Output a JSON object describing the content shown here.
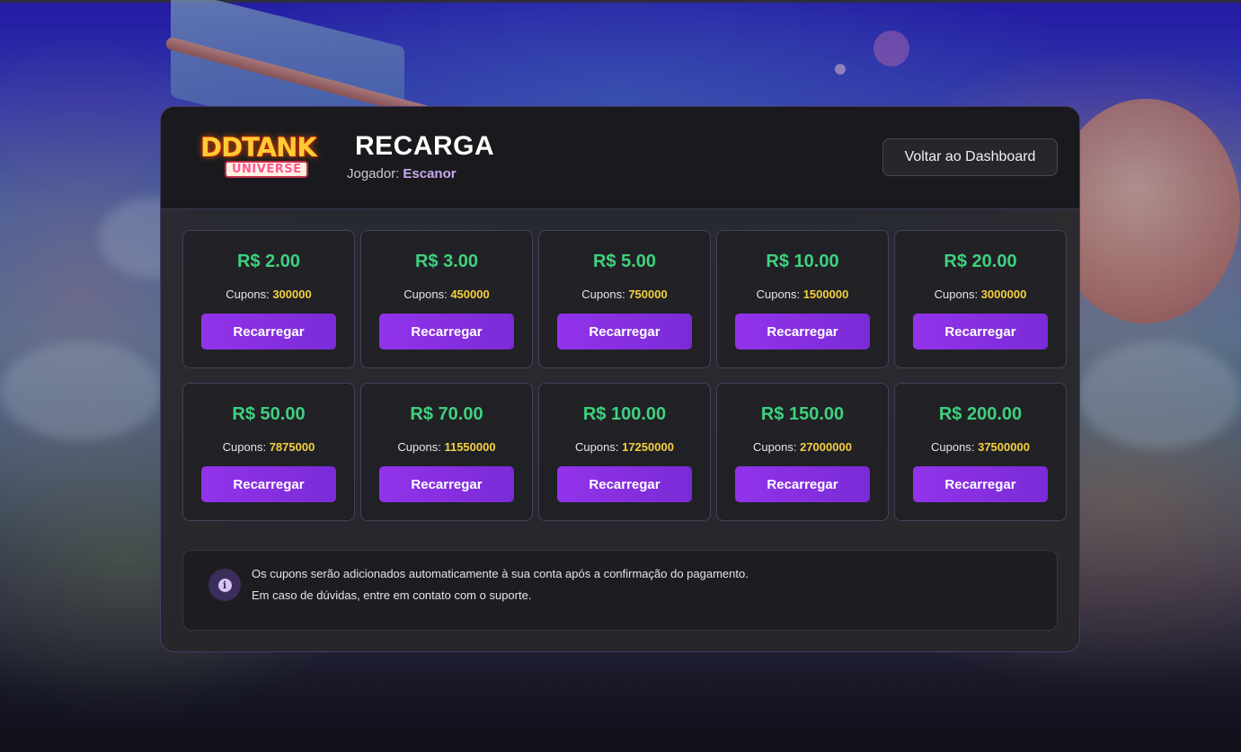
{
  "header": {
    "logo_text": "DDTANK",
    "logo_subtext": "UNIVERSE",
    "title": "RECARGA",
    "player_label": "Jogador:",
    "player_name": "Escanor",
    "back_button": "Voltar ao Dashboard"
  },
  "packages": [
    {
      "price": "R$ 2.00",
      "coupons_label": "Cupons:",
      "coupons": "300000",
      "button": "Recarregar"
    },
    {
      "price": "R$ 3.00",
      "coupons_label": "Cupons:",
      "coupons": "450000",
      "button": "Recarregar"
    },
    {
      "price": "R$ 5.00",
      "coupons_label": "Cupons:",
      "coupons": "750000",
      "button": "Recarregar"
    },
    {
      "price": "R$ 10.00",
      "coupons_label": "Cupons:",
      "coupons": "1500000",
      "button": "Recarregar"
    },
    {
      "price": "R$ 20.00",
      "coupons_label": "Cupons:",
      "coupons": "3000000",
      "button": "Recarregar"
    },
    {
      "price": "R$ 50.00",
      "coupons_label": "Cupons:",
      "coupons": "7875000",
      "button": "Recarregar"
    },
    {
      "price": "R$ 70.00",
      "coupons_label": "Cupons:",
      "coupons": "11550000",
      "button": "Recarregar"
    },
    {
      "price": "R$ 100.00",
      "coupons_label": "Cupons:",
      "coupons": "17250000",
      "button": "Recarregar"
    },
    {
      "price": "R$ 150.00",
      "coupons_label": "Cupons:",
      "coupons": "27000000",
      "button": "Recarregar"
    },
    {
      "price": "R$ 200.00",
      "coupons_label": "Cupons:",
      "coupons": "37500000",
      "button": "Recarregar"
    }
  ],
  "info": {
    "icon": "info-icon",
    "icon_glyph": "i",
    "line1": "Os cupons serão adicionados automaticamente à sua conta após a confirmação do pagamento.",
    "line2": "Em caso de dúvidas, entre em contato com o suporte."
  },
  "colors": {
    "price": "#3fd17e",
    "coupons_value": "#f4d03f",
    "button": "#9233ea",
    "player_name": "#c9a8f0"
  }
}
